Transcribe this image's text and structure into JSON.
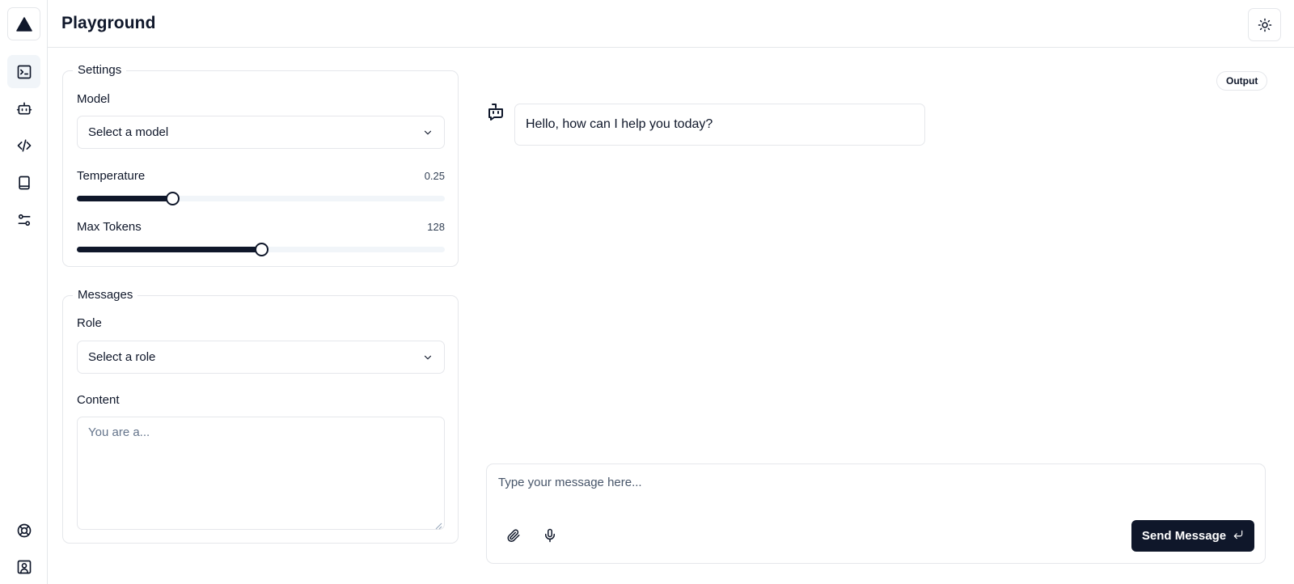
{
  "header": {
    "title": "Playground",
    "theme_icon": "sun-icon"
  },
  "sidebar": {
    "logo_icon": "triangle-logo-icon",
    "items": [
      {
        "name": "terminal",
        "icon": "terminal-icon",
        "active": true
      },
      {
        "name": "models",
        "icon": "bot-icon",
        "active": false
      },
      {
        "name": "api",
        "icon": "code-icon",
        "active": false
      },
      {
        "name": "documentation",
        "icon": "book-icon",
        "active": false
      },
      {
        "name": "settings",
        "icon": "sliders-icon",
        "active": false
      }
    ],
    "bottom_items": [
      {
        "name": "help",
        "icon": "life-buoy-icon"
      },
      {
        "name": "account",
        "icon": "square-user-icon"
      }
    ]
  },
  "settings": {
    "legend": "Settings",
    "model_label": "Model",
    "model_placeholder": "Select a model",
    "temperature_label": "Temperature",
    "temperature_value": "0.25",
    "temperature_fraction": 0.26,
    "max_tokens_label": "Max Tokens",
    "max_tokens_value": "128",
    "max_tokens_fraction": 0.5
  },
  "messages": {
    "legend": "Messages",
    "role_label": "Role",
    "role_placeholder": "Select a role",
    "content_label": "Content",
    "content_placeholder": "You are a..."
  },
  "output": {
    "badge": "Output",
    "bot_message": "Hello, how can I help you today?"
  },
  "composer": {
    "placeholder": "Type your message here...",
    "send_label": "Send Message"
  },
  "colors": {
    "primary": "#0f172a",
    "border": "#e5e7eb",
    "muted": "#f1f5f9"
  }
}
